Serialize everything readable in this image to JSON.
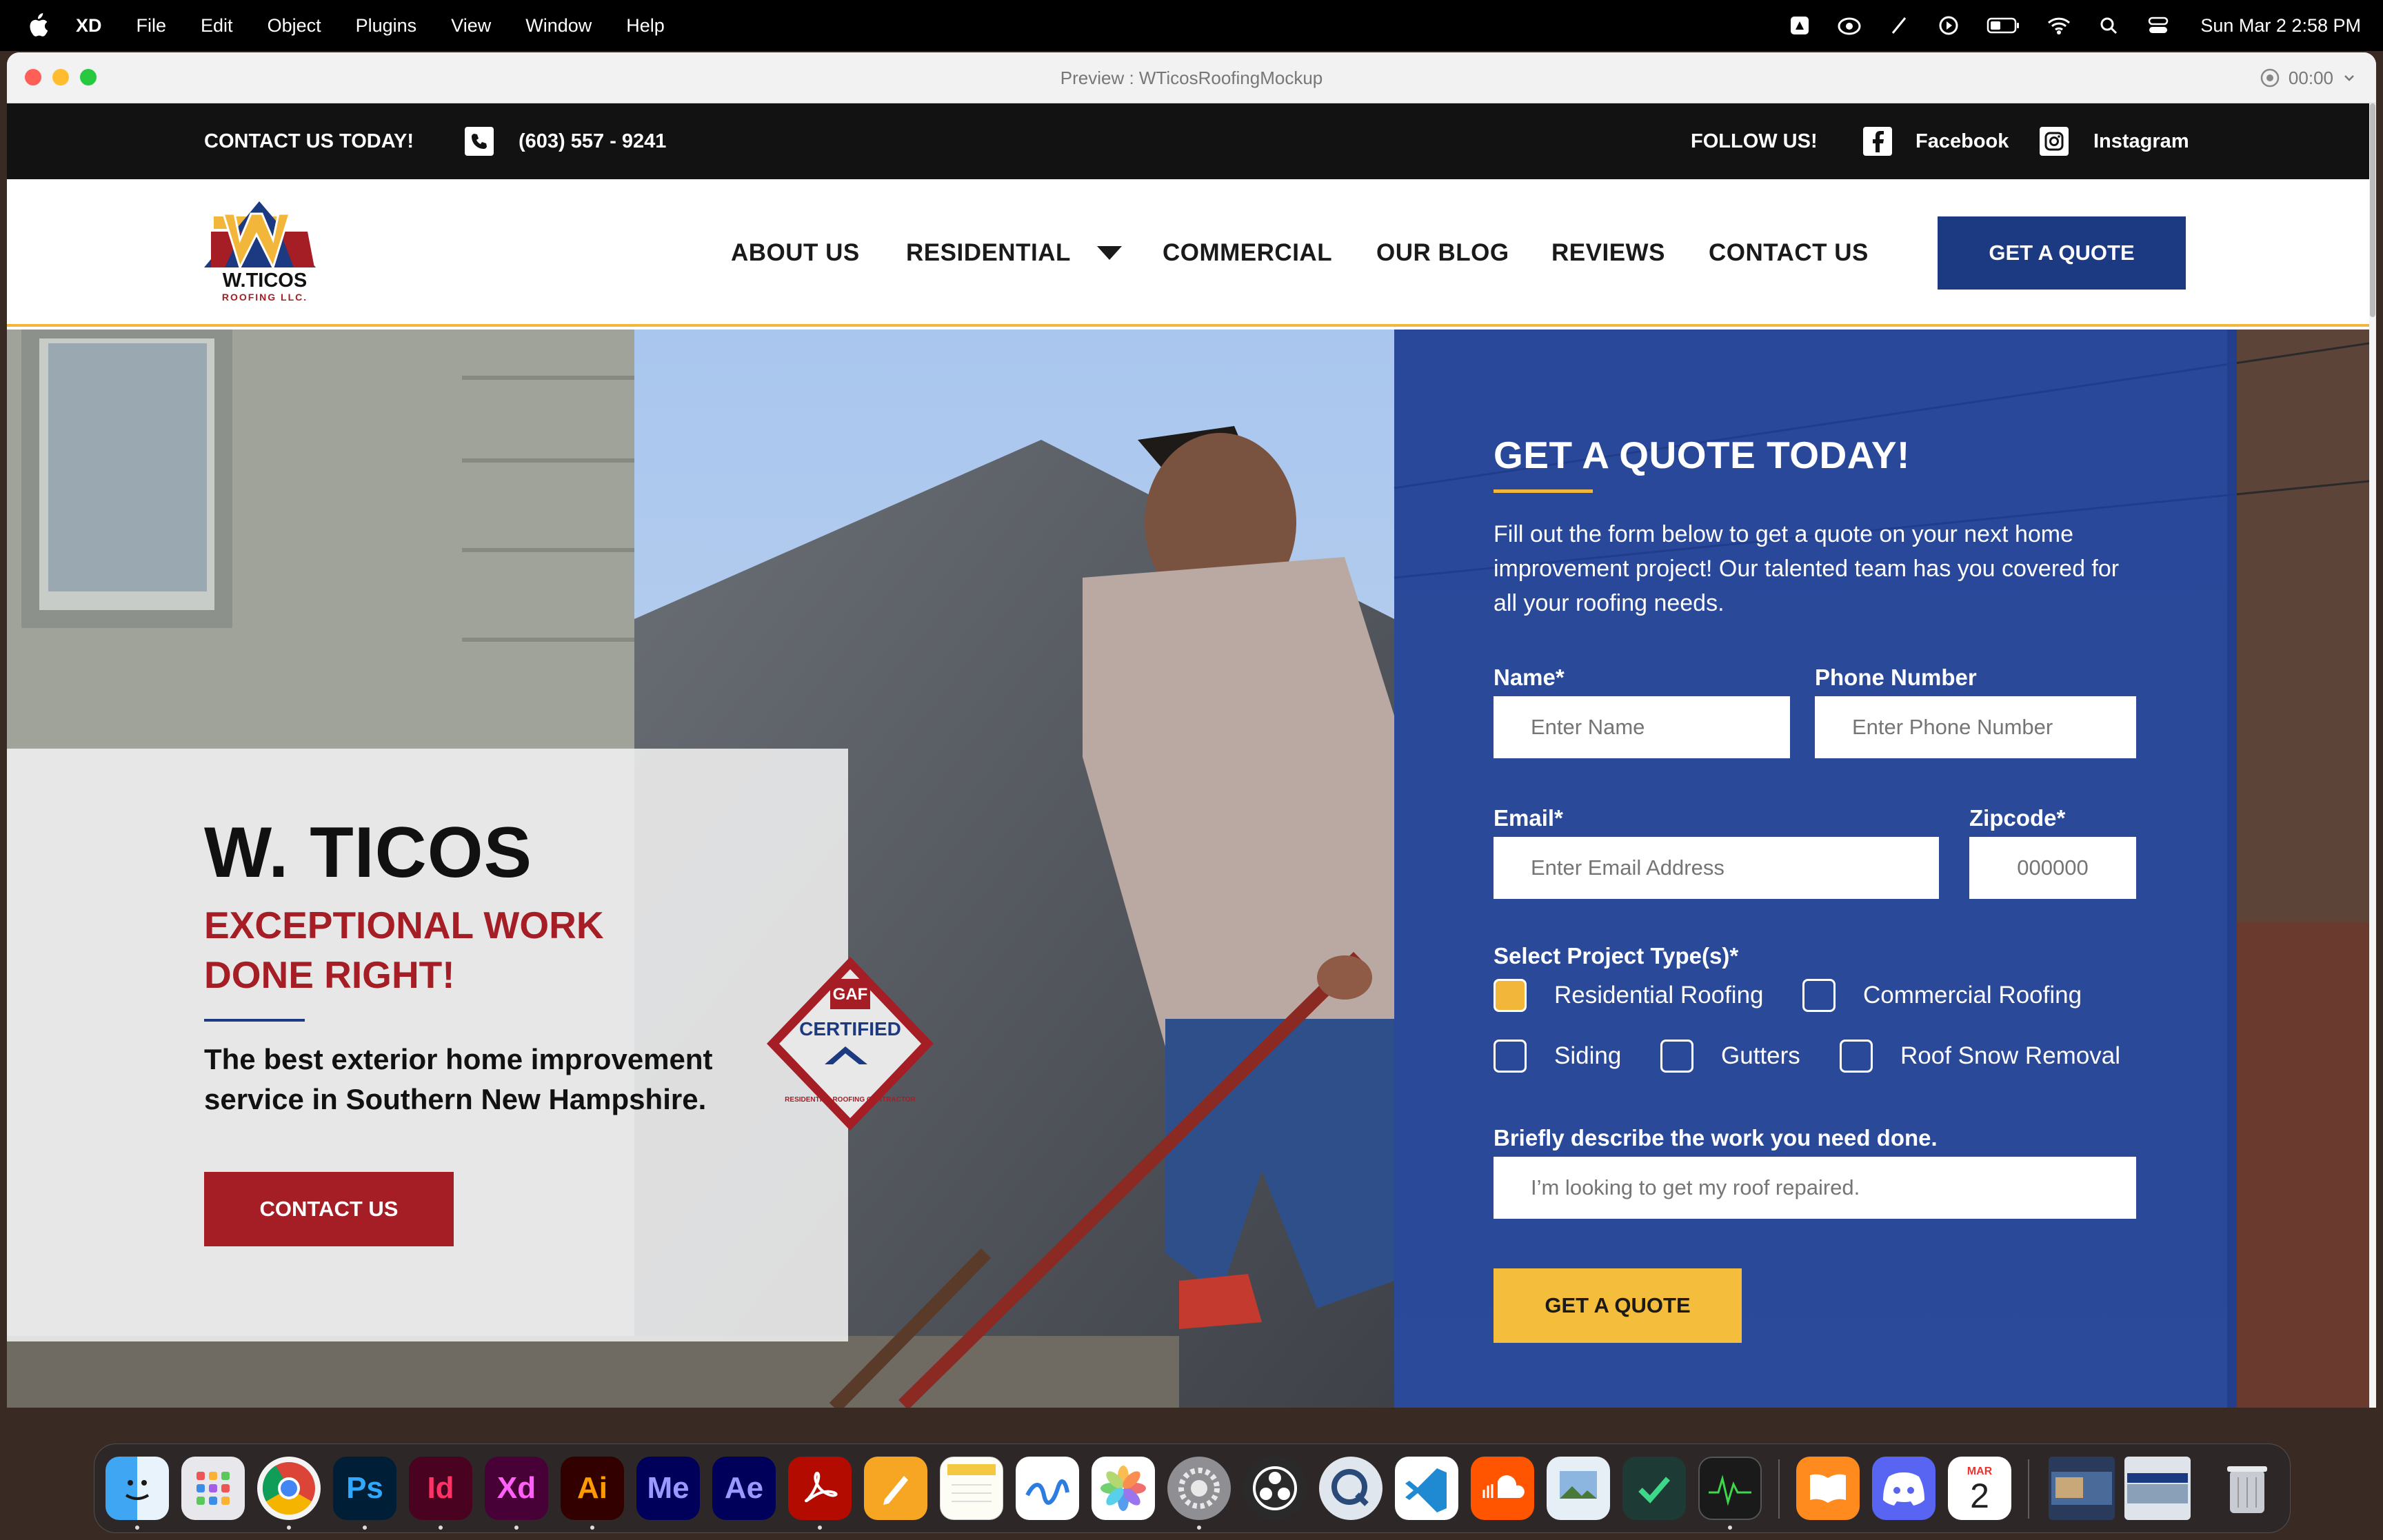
{
  "menubar": {
    "app": "XD",
    "items": [
      "File",
      "Edit",
      "Object",
      "Plugins",
      "View",
      "Window",
      "Help"
    ],
    "clock": "Sun Mar 2  2:58 PM"
  },
  "window": {
    "title": "Preview : WTicosRoofingMockup",
    "record_time": "00:00"
  },
  "topbar": {
    "contact": "CONTACT US TODAY!",
    "phone": "(603) 557 - 9241",
    "follow": "FOLLOW US!",
    "facebook": "Facebook",
    "instagram": "Instagram"
  },
  "logo": {
    "line1": "W.TICOS",
    "line2": "ROOFING LLC."
  },
  "nav": {
    "about": "ABOUT US",
    "residential": "RESIDENTIAL",
    "commercial": "COMMERCIAL",
    "blog": "OUR BLOG",
    "reviews": "REVIEWS",
    "contact": "CONTACT US",
    "quote_button": "GET A QUOTE"
  },
  "hero": {
    "title": "W. TICOS",
    "subtitle": "EXCEPTIONAL WORK DONE RIGHT!",
    "description": "The best exterior home improvement service in Southern New Hampshire.",
    "button": "CONTACT US",
    "badge": {
      "brand": "GAF",
      "certified": "CERTIFIED",
      "ring": "RESIDENTIAL ROOFING CONTRACTOR"
    }
  },
  "form": {
    "title": "GET A QUOTE TODAY!",
    "description": "Fill out the form below to get a quote on your next home improvement project! Our talented team has you covered for all your roofing needs.",
    "name_label": "Name*",
    "name_placeholder": "Enter Name",
    "phone_label": "Phone Number",
    "phone_placeholder": "Enter Phone Number",
    "email_label": "Email*",
    "email_placeholder": "Enter Email Address",
    "zip_label": "Zipcode*",
    "zip_placeholder": "000000",
    "project_label": "Select Project Type(s)*",
    "options": [
      {
        "label": "Residential Roofing",
        "checked": true
      },
      {
        "label": "Commercial Roofing",
        "checked": false
      },
      {
        "label": "Siding",
        "checked": false
      },
      {
        "label": "Gutters",
        "checked": false
      },
      {
        "label": "Roof Snow Removal",
        "checked": false
      }
    ],
    "describe_label": "Briefly describe the work you need done.",
    "describe_placeholder": "I’m looking to get my roof repaired.",
    "submit": "GET A QUOTE"
  },
  "colors": {
    "navy": "#1c3a82",
    "red": "#a61e25",
    "yellow": "#f4bd3c",
    "black_bar": "#121212"
  },
  "dock": {
    "apps": [
      "finder-icon",
      "launchpad-icon",
      "chrome-icon",
      "photoshop-icon",
      "indesign-icon",
      "xd-icon",
      "illustrator-icon",
      "media-encoder-icon",
      "after-effects-icon",
      "acrobat-icon",
      "pages-icon",
      "notes-icon",
      "freeform-icon",
      "photos-icon",
      "system-settings-icon",
      "obs-icon",
      "quicktime-icon",
      "vscode-icon",
      "soundcloud-icon",
      "preview-icon",
      "tick-icon",
      "activity-monitor-icon",
      "books-icon",
      "discord-icon",
      "calendar-icon"
    ],
    "labels": {
      "ps": "Ps",
      "id": "Id",
      "xd": "Xd",
      "ai": "Ai",
      "me": "Me",
      "ae": "Ae"
    },
    "calendar_month": "MAR",
    "calendar_day": "2"
  }
}
